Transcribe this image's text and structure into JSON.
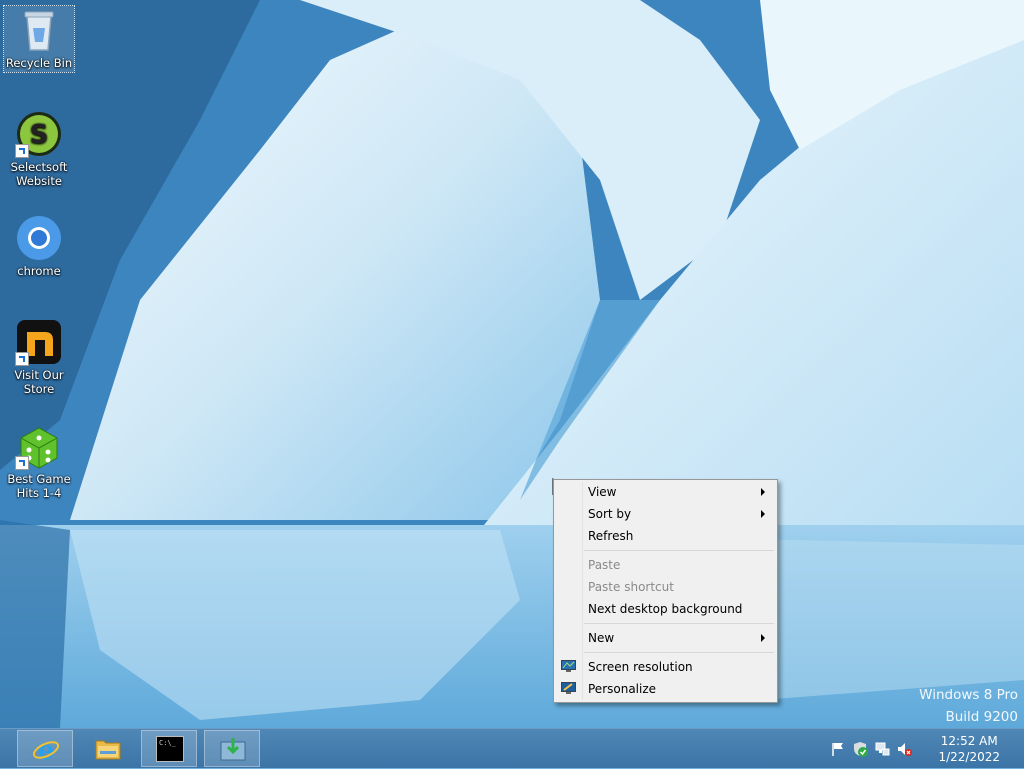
{
  "desktop": {
    "icons": [
      {
        "label": "Recycle Bin",
        "icon": "recycle-bin-icon"
      },
      {
        "label": "Selectsoft Website",
        "icon": "selectsoft-icon"
      },
      {
        "label": "chrome",
        "icon": "chrome-icon"
      },
      {
        "label": "Visit Our Store",
        "icon": "store-icon"
      },
      {
        "label": "Best Game Hits 1-4",
        "icon": "dice-icon"
      }
    ]
  },
  "context_menu": {
    "items": [
      {
        "label": "View",
        "submenu": true,
        "enabled": true
      },
      {
        "label": "Sort by",
        "submenu": true,
        "enabled": true
      },
      {
        "label": "Refresh",
        "enabled": true
      },
      {
        "label": "Paste",
        "enabled": false
      },
      {
        "label": "Paste shortcut",
        "enabled": false
      },
      {
        "label": "Next desktop background",
        "enabled": true
      },
      {
        "label": "New",
        "submenu": true,
        "enabled": true
      },
      {
        "label": "Screen resolution",
        "enabled": true,
        "icon": "monitor-icon"
      },
      {
        "label": "Personalize",
        "enabled": true,
        "icon": "personalize-icon"
      }
    ]
  },
  "watermark": {
    "line1": "Windows 8 Pro",
    "line2": "Build 9200"
  },
  "taskbar": {
    "pinned": [
      {
        "name": "internet-explorer",
        "icon": "ie-icon"
      },
      {
        "name": "file-explorer",
        "icon": "folder-icon"
      },
      {
        "name": "command-prompt",
        "icon": "cmd-icon",
        "icon_text": "C:\\_"
      },
      {
        "name": "installer",
        "icon": "installer-icon"
      }
    ],
    "tray": {
      "icons": [
        "action-center-flag-icon",
        "security-shield-icon",
        "network-icon",
        "volume-muted-icon"
      ],
      "time": "12:52 AM",
      "date": "1/22/2022"
    }
  },
  "colors": {
    "taskbar": "#3b74a6",
    "menu_bg": "#f0f0f0",
    "disabled_text": "#8a8a8a"
  }
}
